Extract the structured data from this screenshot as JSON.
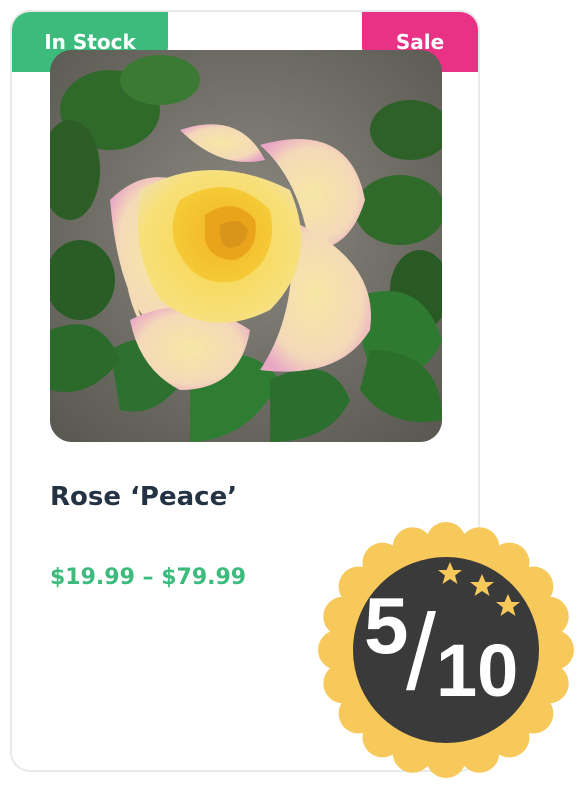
{
  "product": {
    "stock_label": "In Stock",
    "sale_label": "Sale",
    "name": "Rose ‘Peace’",
    "price_range": "$19.99 – $79.99",
    "image_subject": "rose-peace-photo"
  },
  "rating": {
    "score": "5",
    "separator": "/",
    "max": "10",
    "stars": 3,
    "badge_color": "#f7c95a",
    "center_color": "#3a3a3a"
  },
  "colors": {
    "in_stock": "#3dbb7d",
    "sale": "#e93185",
    "title": "#243344",
    "price": "#3dbb7d"
  },
  "icons": [
    "star-icon",
    "star-icon",
    "star-icon"
  ]
}
